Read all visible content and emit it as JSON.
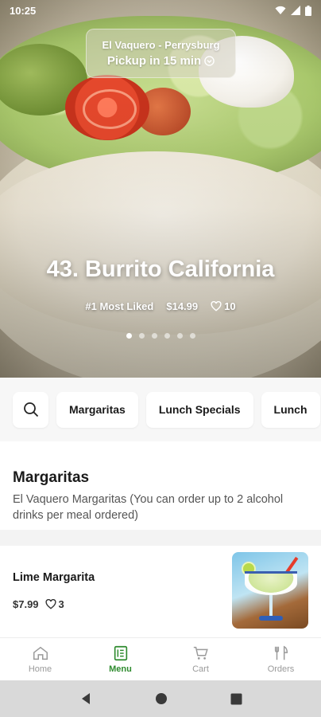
{
  "status_bar": {
    "time": "10:25"
  },
  "hero": {
    "store_name": "El Vaquero - Perrysburg",
    "pickup_text": "Pickup in 15 min",
    "title": "43. Burrito California",
    "badge": "#1 Most Liked",
    "price": "$14.99",
    "likes": "10",
    "carousel": {
      "count": 6,
      "active_index": 0
    }
  },
  "categories": {
    "search_icon": "search-icon",
    "items": [
      "Margaritas",
      "Lunch Specials",
      "Lunch"
    ]
  },
  "section": {
    "title": "Margaritas",
    "description": "El Vaquero Margaritas (You can order up to 2 alcohol  drinks per meal ordered)"
  },
  "items": [
    {
      "name": "Lime Margarita",
      "price": "$7.99",
      "likes": "3"
    }
  ],
  "bottom_nav": {
    "items": [
      {
        "label": "Home",
        "icon": "home-icon"
      },
      {
        "label": "Menu",
        "icon": "menu-icon",
        "active": true
      },
      {
        "label": "Cart",
        "icon": "cart-icon"
      },
      {
        "label": "Orders",
        "icon": "orders-icon"
      }
    ]
  },
  "colors": {
    "accent": "#2e8b2e",
    "inactive": "#9a9a9a"
  }
}
